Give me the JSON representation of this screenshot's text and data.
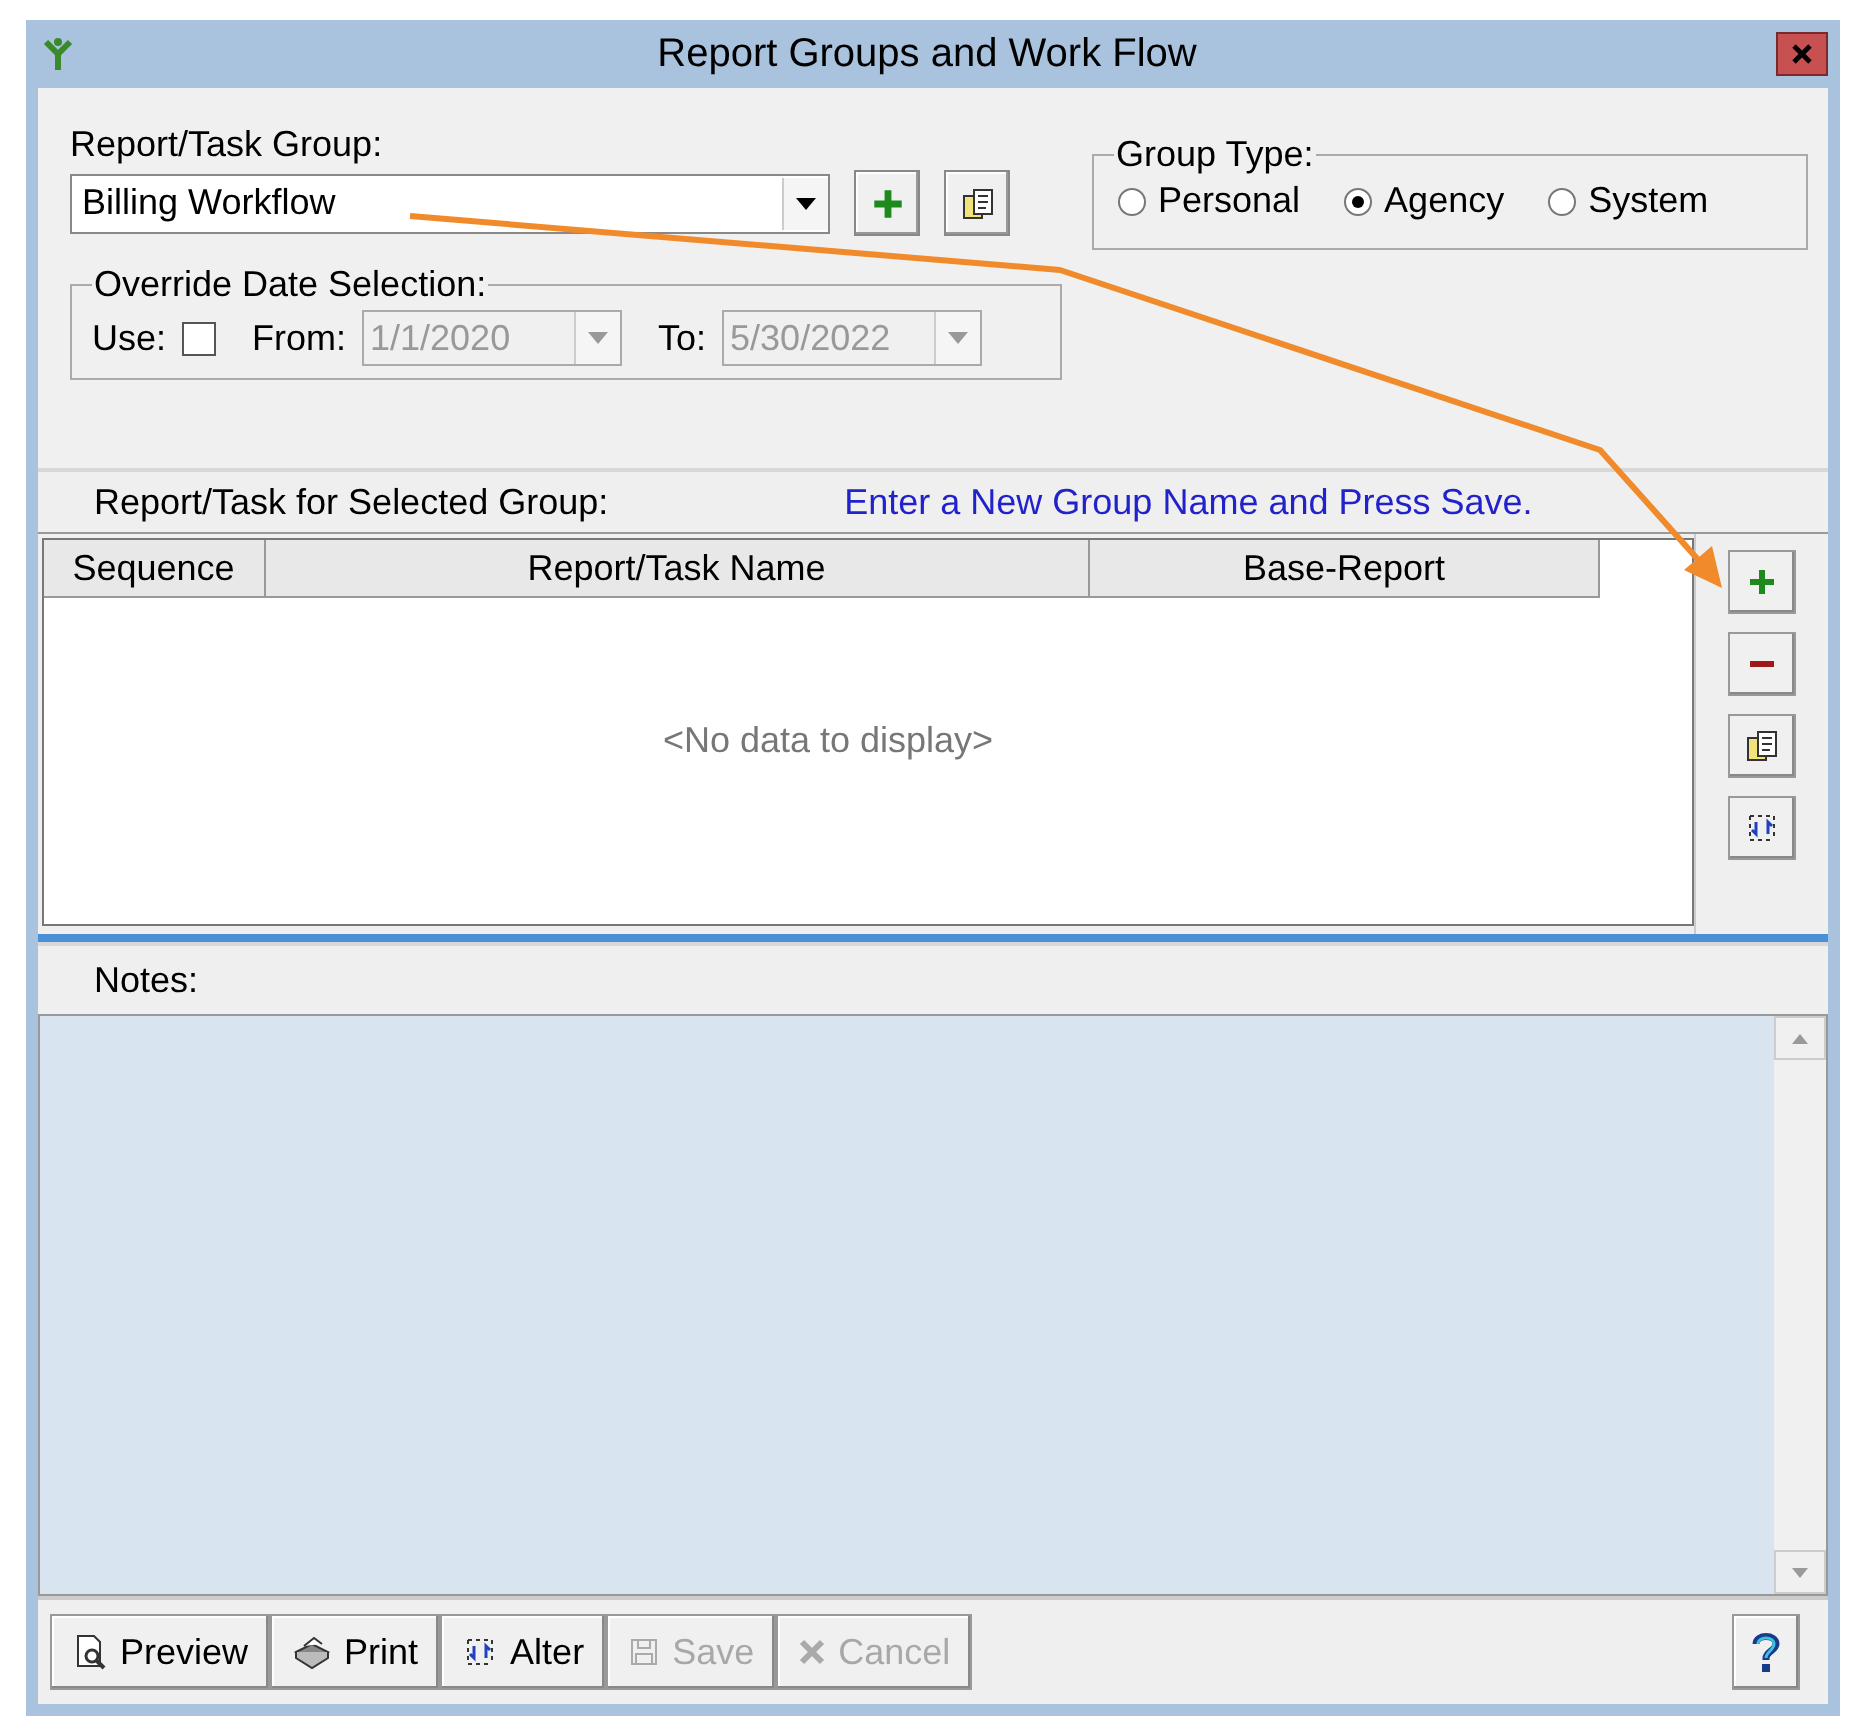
{
  "window": {
    "title": "Report Groups and Work Flow"
  },
  "group": {
    "label": "Report/Task Group:",
    "value": "Billing Workflow"
  },
  "group_type": {
    "legend": "Group Type:",
    "options": [
      {
        "label": "Personal",
        "selected": false
      },
      {
        "label": "Agency",
        "selected": true
      },
      {
        "label": "System",
        "selected": false
      }
    ]
  },
  "override": {
    "legend": "Override Date Selection:",
    "use_label": "Use:",
    "checked": false,
    "from_label": "From:",
    "from_value": "1/1/2020",
    "to_label": "To:",
    "to_value": "5/30/2022",
    "disabled": true
  },
  "tasks": {
    "title": "Report/Task for Selected Group:",
    "hint": "Enter a New Group Name and Press Save.",
    "columns": [
      "Sequence",
      "Report/Task Name",
      "Base-Report"
    ],
    "empty": "<No data to display>"
  },
  "notes": {
    "title": "Notes:"
  },
  "toolbar": [
    {
      "label": "Preview",
      "kind": "preview",
      "disabled": false
    },
    {
      "label": "Print",
      "kind": "print",
      "disabled": false
    },
    {
      "label": "Alter",
      "kind": "alter",
      "disabled": false
    },
    {
      "label": "Save",
      "kind": "save",
      "disabled": true
    },
    {
      "label": "Cancel",
      "kind": "cancel",
      "disabled": true
    }
  ]
}
